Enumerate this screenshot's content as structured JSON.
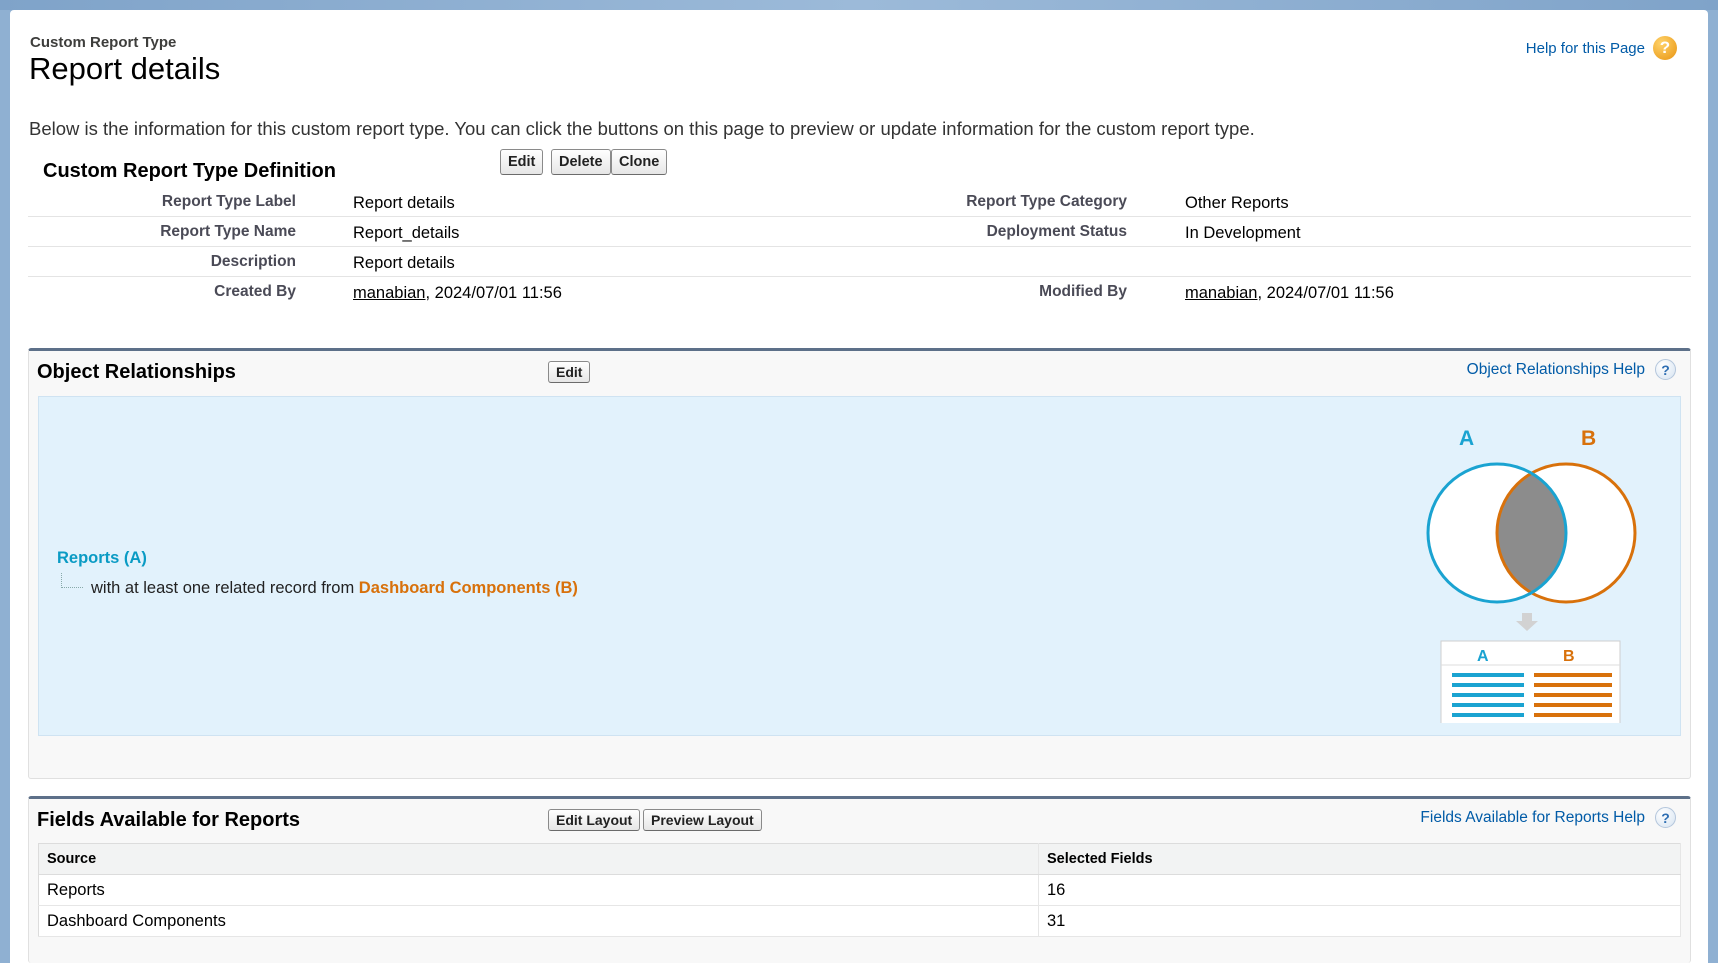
{
  "header": {
    "breadcrumb": "Custom Report Type",
    "title": "Report details",
    "help_link": "Help for this Page",
    "intro": "Below is the information for this custom report type. You can click the buttons on this page to preview or update information for the custom report type."
  },
  "definition": {
    "heading": "Custom Report Type Definition",
    "buttons": {
      "edit": "Edit",
      "delete": "Delete",
      "clone": "Clone"
    },
    "fields": {
      "label_label": "Report Type Label",
      "label_value": "Report details",
      "name_label": "Report Type Name",
      "name_value": "Report_details",
      "description_label": "Description",
      "description_value": "Report details",
      "created_label": "Created By",
      "created_user": "manabian",
      "created_time": ", 2024/07/01 11:56",
      "category_label": "Report Type Category",
      "category_value": "Other Reports",
      "status_label": "Deployment Status",
      "status_value": "In Development",
      "modified_label": "Modified By",
      "modified_user": "manabian",
      "modified_time": ", 2024/07/01 11:56"
    }
  },
  "relationships": {
    "heading": "Object Relationships",
    "edit_button": "Edit",
    "help_link": "Object Relationships Help",
    "primary": "Reports (A)",
    "relation_text": "with at least one related record from ",
    "secondary": "Dashboard Components (B)",
    "diagram": {
      "a_label": "A",
      "b_label": "B",
      "color_a": "#1aa3d1",
      "color_b": "#d8710b"
    }
  },
  "fields_available": {
    "heading": "Fields Available for Reports",
    "edit_layout_button": "Edit Layout",
    "preview_layout_button": "Preview Layout",
    "help_link": "Fields Available for Reports Help",
    "columns": [
      "Source",
      "Selected Fields"
    ],
    "rows": [
      {
        "source": "Reports",
        "count": "16"
      },
      {
        "source": "Dashboard Components",
        "count": "31"
      }
    ]
  }
}
